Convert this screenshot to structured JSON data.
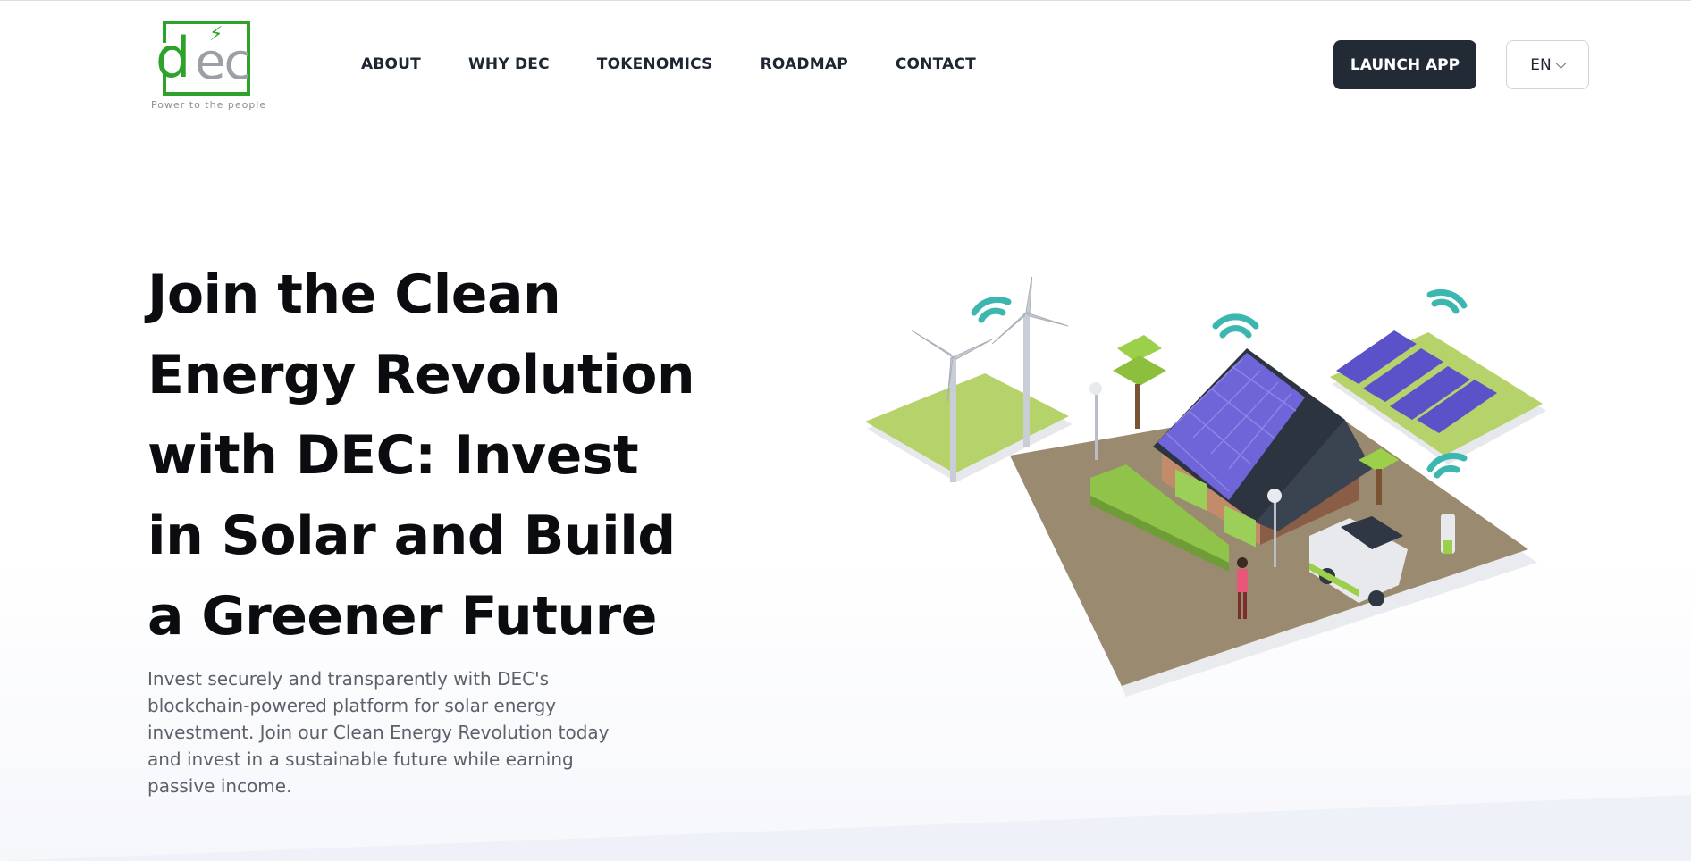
{
  "brand": {
    "logo_text_left": "d",
    "logo_text_right": "ec",
    "tagline": "Power to the people",
    "logo_color": "#2ea32b"
  },
  "nav": {
    "items": [
      "ABOUT",
      "WHY DEC",
      "TOKENOMICS",
      "ROADMAP",
      "CONTACT"
    ]
  },
  "header": {
    "launch_label": "LAUNCH APP",
    "language": "EN"
  },
  "hero": {
    "title": "Join the Clean Energy Revolution with DEC: Invest in Solar and Build a Greener Future",
    "description": "Invest securely and transparently with DEC's blockchain-powered platform for solar energy investment. Join our Clean Energy Revolution today and invest in a sustainable future while earning passive income.",
    "illustration": "isometric-solar-house-illustration"
  },
  "colors": {
    "button_dark": "#222a36",
    "text_dark": "#0b0c10",
    "text_muted": "#5b616b"
  }
}
